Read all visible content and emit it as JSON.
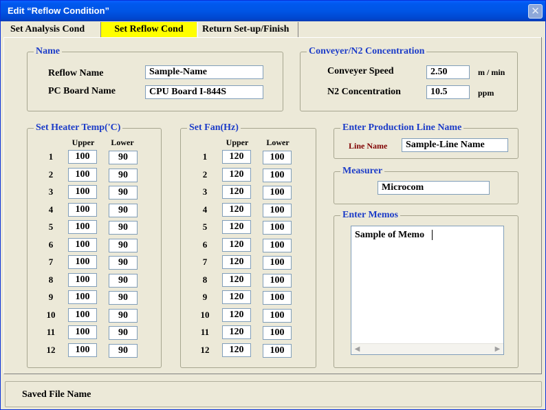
{
  "window": {
    "title": "Edit “Reflow Condition”",
    "close_glyph": "✕"
  },
  "tabs": [
    {
      "label": "Set Analysis Cond"
    },
    {
      "label": "Set Reflow Cond"
    },
    {
      "label": "Return Set-up/Finish"
    }
  ],
  "name_group": {
    "title": "Name",
    "reflow_name_label": "Reflow Name",
    "reflow_name_value": "Sample-Name",
    "pcb_name_label": "PC Board Name",
    "pcb_name_value": "CPU Board I-844S"
  },
  "conveyer_group": {
    "title": "Conveyer/N2 Concentration",
    "speed_label": "Conveyer Speed",
    "speed_value": "2.50",
    "speed_unit": "m / min",
    "n2_label": "N2 Concentration",
    "n2_value": "10.5",
    "n2_unit": "ppm"
  },
  "heater_group": {
    "title": "Set Heater Temp('C)",
    "upper_header": "Upper",
    "lower_header": "Lower",
    "rows": [
      {
        "no": "1",
        "upper": "100",
        "lower": "90"
      },
      {
        "no": "2",
        "upper": "100",
        "lower": "90"
      },
      {
        "no": "3",
        "upper": "100",
        "lower": "90"
      },
      {
        "no": "4",
        "upper": "100",
        "lower": "90"
      },
      {
        "no": "5",
        "upper": "100",
        "lower": "90"
      },
      {
        "no": "6",
        "upper": "100",
        "lower": "90"
      },
      {
        "no": "7",
        "upper": "100",
        "lower": "90"
      },
      {
        "no": "8",
        "upper": "100",
        "lower": "90"
      },
      {
        "no": "9",
        "upper": "100",
        "lower": "90"
      },
      {
        "no": "10",
        "upper": "100",
        "lower": "90"
      },
      {
        "no": "11",
        "upper": "100",
        "lower": "90"
      },
      {
        "no": "12",
        "upper": "100",
        "lower": "90"
      }
    ]
  },
  "fan_group": {
    "title": "Set Fan(Hz)",
    "upper_header": "Upper",
    "lower_header": "Lower",
    "rows": [
      {
        "no": "1",
        "upper": "120",
        "lower": "100"
      },
      {
        "no": "2",
        "upper": "120",
        "lower": "100"
      },
      {
        "no": "3",
        "upper": "120",
        "lower": "100"
      },
      {
        "no": "4",
        "upper": "120",
        "lower": "100"
      },
      {
        "no": "5",
        "upper": "120",
        "lower": "100"
      },
      {
        "no": "6",
        "upper": "120",
        "lower": "100"
      },
      {
        "no": "7",
        "upper": "120",
        "lower": "100"
      },
      {
        "no": "8",
        "upper": "120",
        "lower": "100"
      },
      {
        "no": "9",
        "upper": "120",
        "lower": "100"
      },
      {
        "no": "10",
        "upper": "120",
        "lower": "100"
      },
      {
        "no": "11",
        "upper": "120",
        "lower": "100"
      },
      {
        "no": "12",
        "upper": "120",
        "lower": "100"
      }
    ]
  },
  "production_line_group": {
    "title": "Enter Production Line Name",
    "line_name_label": "Line Name",
    "line_name_value": "Sample-Line Name"
  },
  "measurer_group": {
    "title": "Measurer",
    "value": "Microcom"
  },
  "memos_group": {
    "title": "Enter Memos",
    "value": "Sample of Memo"
  },
  "status": {
    "saved_file_label": "Saved File Name"
  },
  "colors": {
    "title_bar": "#0055e5",
    "active_tab": "#ffff00",
    "group_title": "#1c3cc8",
    "line_name_label": "#800000",
    "dialog_bg": "#ece9d8"
  },
  "icons": {
    "close": "close-icon",
    "scroll_left": "arrow-left-icon",
    "scroll_right": "arrow-right-icon"
  }
}
